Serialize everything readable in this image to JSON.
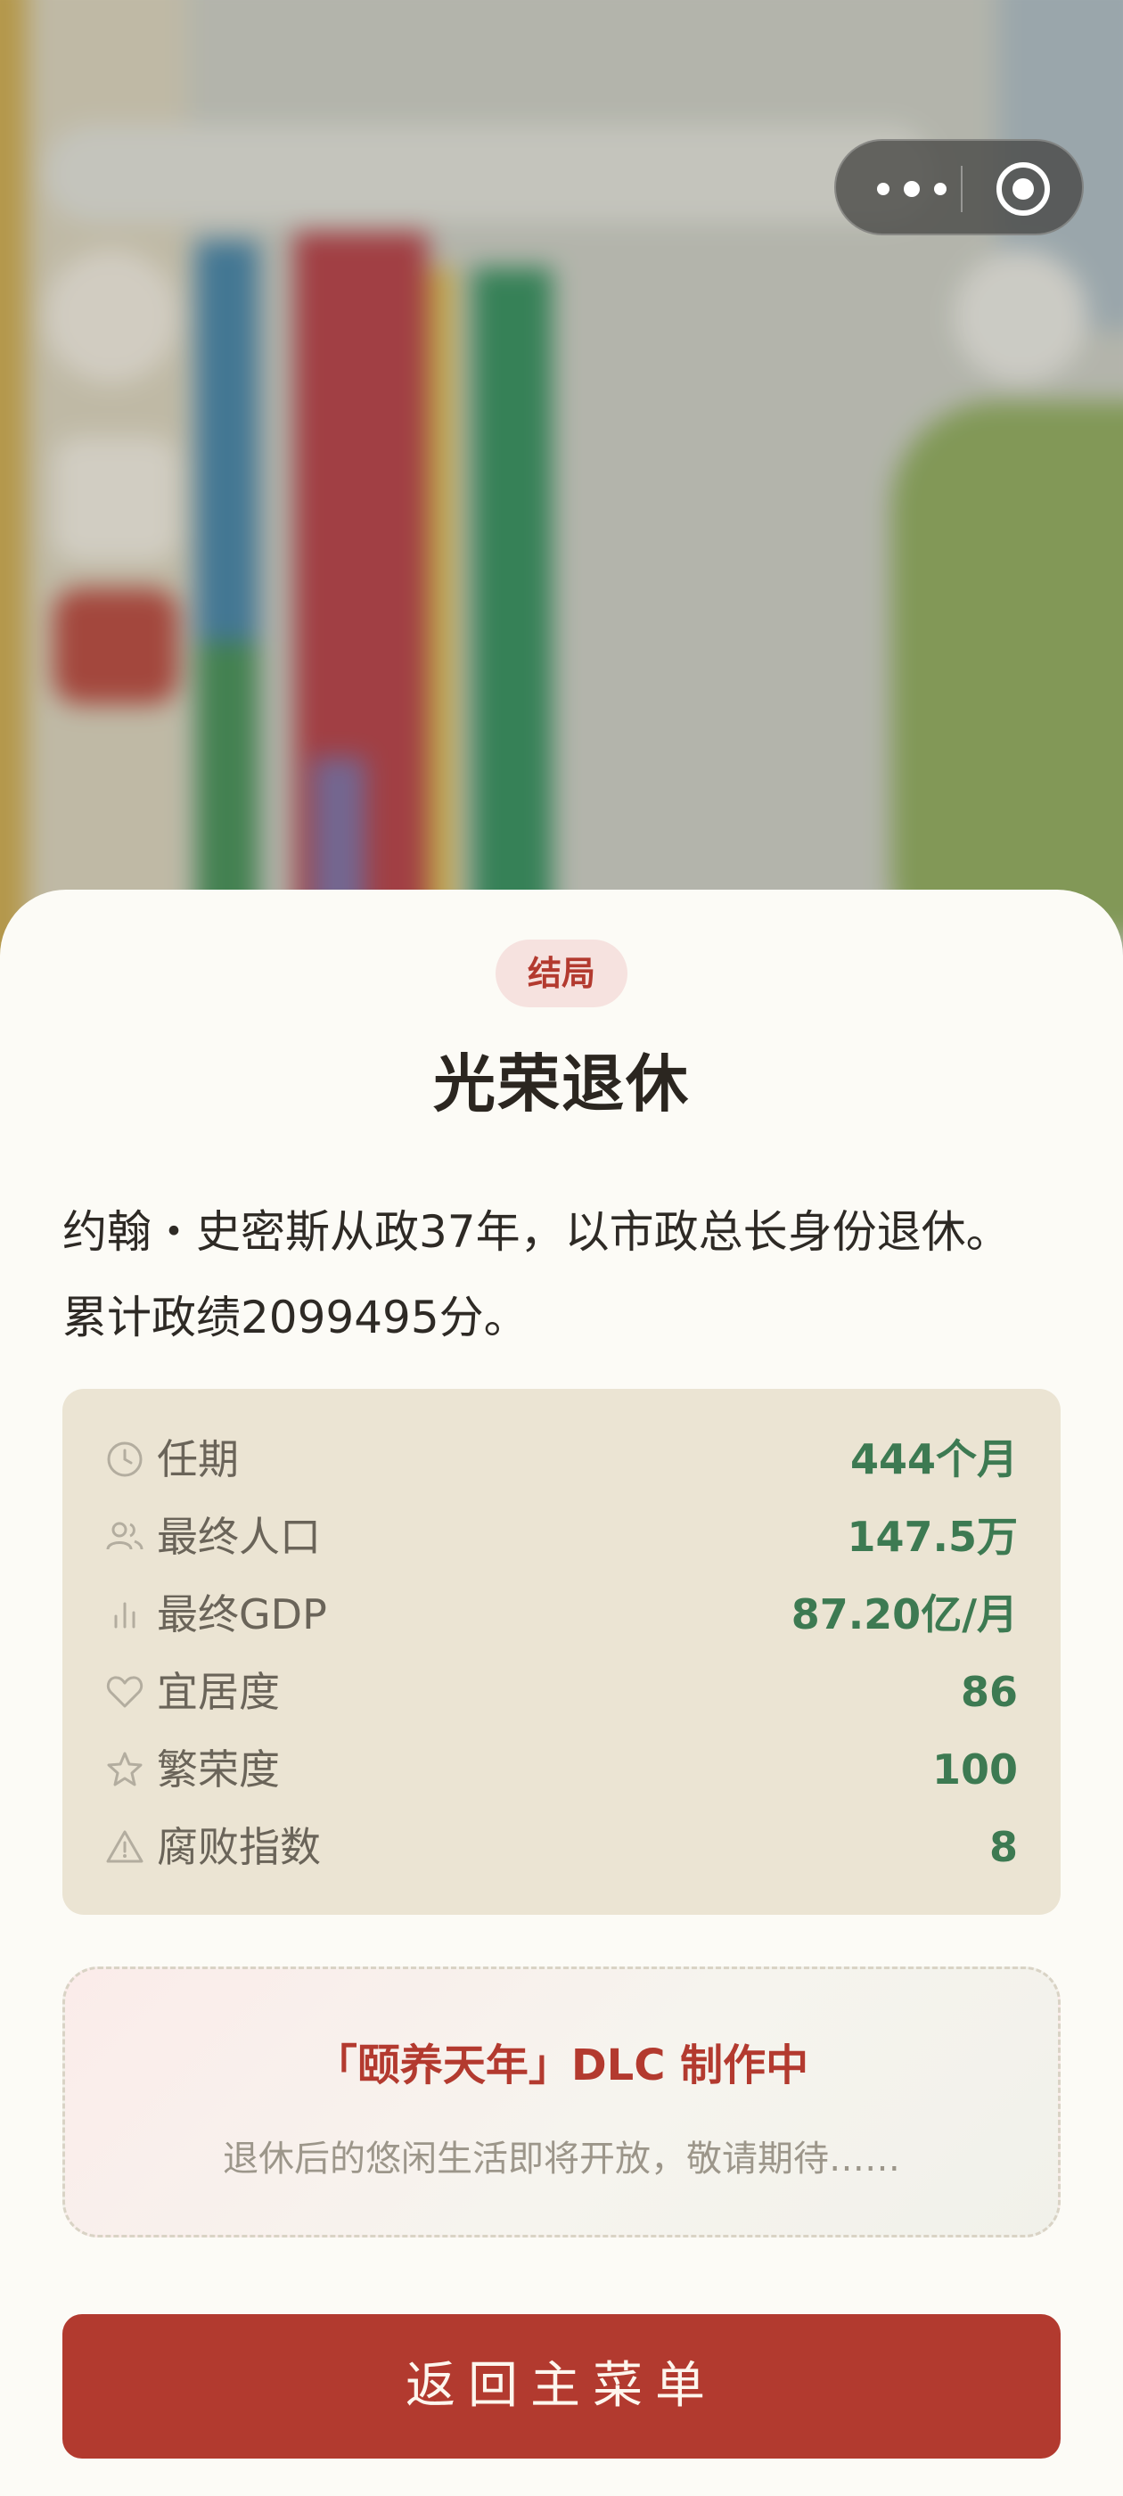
{
  "capsule": {
    "more_icon": "more-dots-icon",
    "close_icon": "record-close-icon"
  },
  "result": {
    "tag": "结局",
    "title": "光荣退休",
    "description_line1": "约翰・史密斯从政37年，以市政总长身份退休。",
    "description_line2": "累计政绩2099495分。"
  },
  "stats": [
    {
      "icon": "clock-icon",
      "label": "任期",
      "value": "444个月"
    },
    {
      "icon": "users-icon",
      "label": "最终人口",
      "value": "147.5万"
    },
    {
      "icon": "bar-chart-icon",
      "label": "最终GDP",
      "value": "87.20亿/月"
    },
    {
      "icon": "heart-icon",
      "label": "宜居度",
      "value": "86"
    },
    {
      "icon": "star-icon",
      "label": "繁荣度",
      "value": "100"
    },
    {
      "icon": "warning-icon",
      "label": "腐败指数",
      "value": "8"
    }
  ],
  "dlc": {
    "title": "「颐养天年」DLC 制作中",
    "subtitle": "退休后的悠闲生活即将开放，敬请期待……"
  },
  "home_button": {
    "label": "返回主菜单"
  },
  "colors": {
    "accent_red": "#b23a2f",
    "value_green": "#3d7a52",
    "sheet_bg": "#fcfbf6",
    "stats_bg": "#ebe4d3"
  }
}
